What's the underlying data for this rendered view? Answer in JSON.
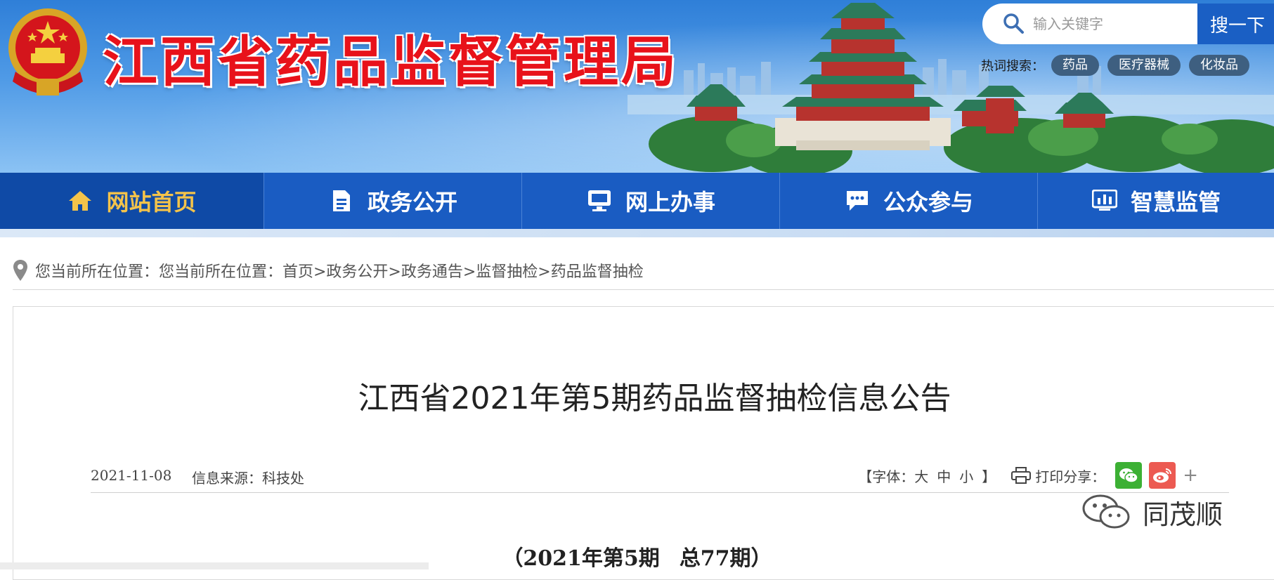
{
  "header": {
    "site_title": "江西省药品监督管理局",
    "search": {
      "placeholder": "输入关键字",
      "button_label": "搜一下"
    },
    "hotwords": {
      "label": "热词搜索：",
      "tags": [
        "药品",
        "医疗器械",
        "化妆品"
      ]
    }
  },
  "nav": {
    "items": [
      {
        "label": "网站首页",
        "icon": "home-icon",
        "active": true
      },
      {
        "label": "政务公开",
        "icon": "document-icon",
        "active": false
      },
      {
        "label": "网上办事",
        "icon": "monitor-icon",
        "active": false
      },
      {
        "label": "公众参与",
        "icon": "chat-icon",
        "active": false
      },
      {
        "label": "智慧监管",
        "icon": "chart-icon",
        "active": false
      }
    ]
  },
  "breadcrumb": {
    "text": "您当前所在位置：您当前所在位置：首页>政务公开>政务通告>监督抽检>药品监督抽检"
  },
  "article": {
    "title": "江西省2021年第5期药品监督抽检信息公告",
    "date": "2021-11-08",
    "source": "信息来源：科技处",
    "font_label_open": "【字体：",
    "font_large": "大",
    "font_medium": "中",
    "font_small": "小",
    "font_label_close": "】",
    "print_label": "打印",
    "share_label": "分享：",
    "share_more": "+",
    "issue_part1": "（2021年第5期",
    "issue_part2": "总77期）"
  },
  "watermark": {
    "text": "同茂顺"
  },
  "colors": {
    "title_red": "#e8121a",
    "nav_blue": "#1a5cc2",
    "nav_active_text": "#f4c34a",
    "wechat_green": "#3cb034",
    "weibo_red": "#ec5a52"
  }
}
